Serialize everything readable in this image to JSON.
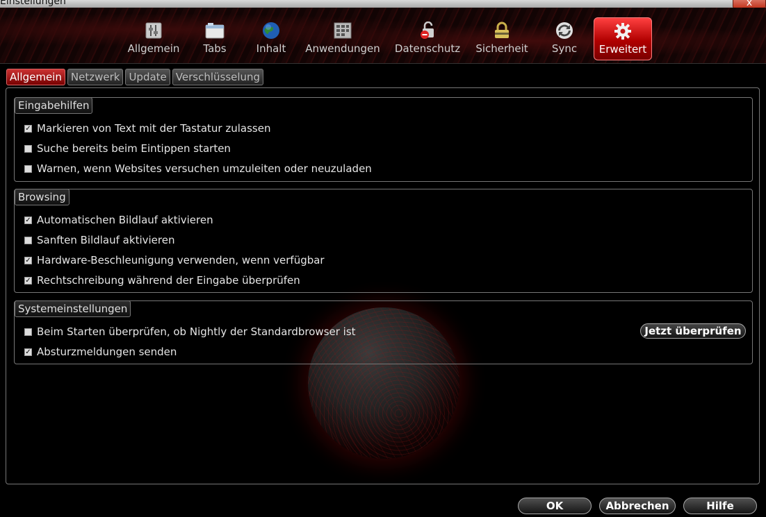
{
  "window": {
    "title": "Einstellungen",
    "close_label": "x"
  },
  "toolbar": {
    "panes": [
      {
        "label": "Allgemein",
        "icon": "switch-panel-icon"
      },
      {
        "label": "Tabs",
        "icon": "tabs-window-icon"
      },
      {
        "label": "Inhalt",
        "icon": "globe-icon"
      },
      {
        "label": "Anwendungen",
        "icon": "applications-grid-icon"
      },
      {
        "label": "Datenschutz",
        "icon": "privacy-lock-icon"
      },
      {
        "label": "Sicherheit",
        "icon": "security-padlock-icon"
      },
      {
        "label": "Sync",
        "icon": "sync-arrows-icon"
      },
      {
        "label": "Erweitert",
        "icon": "gear-icon"
      }
    ],
    "active_pane": "Erweitert"
  },
  "subtabs": [
    "Allgemein",
    "Netzwerk",
    "Update",
    "Verschlüsselung"
  ],
  "groups": {
    "eingabehilfen": {
      "title": "Eingabehilfen",
      "options": [
        {
          "label": "Markieren von Text mit der Tastatur zulassen",
          "checked": true
        },
        {
          "label": "Suche bereits beim Eintippen starten",
          "checked": false
        },
        {
          "label": "Warnen, wenn Websites versuchen umzuleiten oder neuzuladen",
          "checked": false
        }
      ]
    },
    "browsing": {
      "title": "Browsing",
      "options": [
        {
          "label": "Automatischen Bildlauf aktivieren",
          "checked": true
        },
        {
          "label": "Sanften Bildlauf aktivieren",
          "checked": false
        },
        {
          "label": "Hardware-Beschleunigung verwenden, wenn verfügbar",
          "checked": true
        },
        {
          "label": "Rechtschreibung während der Eingabe überprüfen",
          "checked": true
        }
      ]
    },
    "system": {
      "title": "Systemeinstellungen",
      "options": [
        {
          "label": "Beim Starten überprüfen, ob Nightly der Standardbrowser ist",
          "checked": false
        },
        {
          "label": "Absturzmeldungen senden",
          "checked": true
        }
      ],
      "check_now_label": "Jetzt überprüfen"
    }
  },
  "footer": {
    "ok": "OK",
    "cancel": "Abbrechen",
    "help": "Hilfe"
  },
  "colors": {
    "accent": "#c01818",
    "background": "#000000",
    "text": "#e6e6e6"
  }
}
